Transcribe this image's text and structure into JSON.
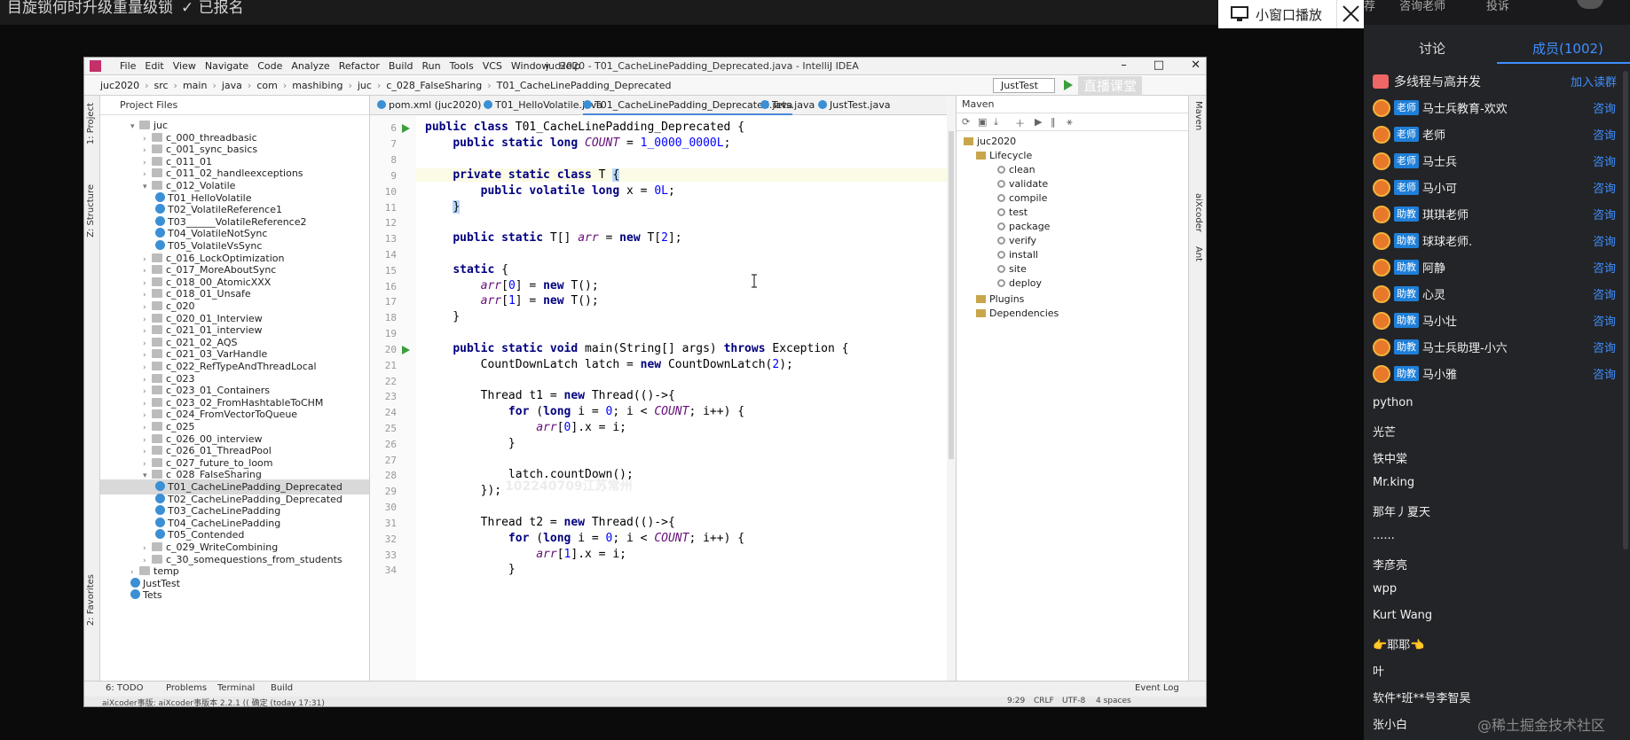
{
  "player": {
    "top_text": "目旋锁何时升级重量级锁",
    "check_text": "✓ 已报名",
    "pip_label": "小窗口播放"
  },
  "side": {
    "top_items": [
      "荐",
      "咨询老师",
      "投诉"
    ],
    "tabs": {
      "discuss": "讨论",
      "members": "成员(1002)"
    },
    "group_name": "多线程与高并发",
    "join_label": "加入读群",
    "members": [
      {
        "badge": "老师",
        "name": "马士兵教育-欢欢",
        "ask": "咨询"
      },
      {
        "badge": "老师",
        "name": "老师",
        "ask": "咨询"
      },
      {
        "badge": "老师",
        "name": "马士兵",
        "ask": "咨询"
      },
      {
        "badge": "老师",
        "name": "马小可",
        "ask": "咨询"
      },
      {
        "badge": "助教",
        "name": "琪琪老师",
        "ask": "咨询"
      },
      {
        "badge": "助教",
        "name": "球球老师.",
        "ask": "咨询"
      },
      {
        "badge": "助教",
        "name": "阿静",
        "ask": "咨询"
      },
      {
        "badge": "助教",
        "name": "心灵",
        "ask": "咨询"
      },
      {
        "badge": "助教",
        "name": "马小壮",
        "ask": "咨询"
      },
      {
        "badge": "助教",
        "name": "马士兵助理-小六",
        "ask": "咨询"
      },
      {
        "badge": "助教",
        "name": "马小雅",
        "ask": "咨询"
      }
    ],
    "plain_members": [
      "python",
      "光芒",
      "铁中棠",
      "Mr.king",
      "那年丿夏天",
      "......",
      "李彦亮",
      "wpp",
      "Kurt Wang",
      "👉耶耶👈",
      "叶",
      "软件*班**号李智昊",
      "张小白"
    ],
    "watermark": "@稀土掘金技术社区"
  },
  "ide": {
    "menu": [
      "File",
      "Edit",
      "View",
      "Navigate",
      "Code",
      "Analyze",
      "Refactor",
      "Build",
      "Run",
      "Tools",
      "VCS",
      "Window",
      "Help"
    ],
    "title": "juc2020 - T01_CacheLinePadding_Deprecated.java - IntelliJ IDEA",
    "breadcrumb": [
      "juc2020",
      "src",
      "main",
      "java",
      "com",
      "mashibing",
      "juc",
      "c_028_FalseSharing",
      "T01_CacheLinePadding_Deprecated"
    ],
    "run_config": "JustTest",
    "overlay_badge": "直播课堂",
    "left_tools": [
      "1: Project",
      "Z: Structure",
      "2: Favorites"
    ],
    "project_head": "Project Files",
    "tree": [
      {
        "label": "juc",
        "type": "folder",
        "indent": 1,
        "open": true
      },
      {
        "label": "c_000_threadbasic",
        "type": "folder",
        "indent": 2
      },
      {
        "label": "c_001_sync_basics",
        "type": "folder",
        "indent": 2
      },
      {
        "label": "c_011_01",
        "type": "folder",
        "indent": 2
      },
      {
        "label": "c_011_02_handleexceptions",
        "type": "folder",
        "indent": 2
      },
      {
        "label": "c_012_Volatile",
        "type": "folder",
        "indent": 2,
        "open": true
      },
      {
        "label": "T01_HelloVolatile",
        "type": "class",
        "indent": 3
      },
      {
        "label": "T02_VolatileReference1",
        "type": "class",
        "indent": 3
      },
      {
        "label": "T03______VolatileReference2",
        "type": "class",
        "indent": 3
      },
      {
        "label": "T04_VolatileNotSync",
        "type": "class",
        "indent": 3
      },
      {
        "label": "T05_VolatileVsSync",
        "type": "class",
        "indent": 3
      },
      {
        "label": "c_016_LockOptimization",
        "type": "folder",
        "indent": 2
      },
      {
        "label": "c_017_MoreAboutSync",
        "type": "folder",
        "indent": 2
      },
      {
        "label": "c_018_00_AtomicXXX",
        "type": "folder",
        "indent": 2
      },
      {
        "label": "c_018_01_Unsafe",
        "type": "folder",
        "indent": 2
      },
      {
        "label": "c_020",
        "type": "folder",
        "indent": 2
      },
      {
        "label": "c_020_01_Interview",
        "type": "folder",
        "indent": 2
      },
      {
        "label": "c_021_01_interview",
        "type": "folder",
        "indent": 2
      },
      {
        "label": "c_021_02_AQS",
        "type": "folder",
        "indent": 2
      },
      {
        "label": "c_021_03_VarHandle",
        "type": "folder",
        "indent": 2
      },
      {
        "label": "c_022_RefTypeAndThreadLocal",
        "type": "folder",
        "indent": 2
      },
      {
        "label": "c_023",
        "type": "folder",
        "indent": 2
      },
      {
        "label": "c_023_01_Containers",
        "type": "folder",
        "indent": 2
      },
      {
        "label": "c_023_02_FromHashtableToCHM",
        "type": "folder",
        "indent": 2
      },
      {
        "label": "c_024_FromVectorToQueue",
        "type": "folder",
        "indent": 2
      },
      {
        "label": "c_025",
        "type": "folder",
        "indent": 2
      },
      {
        "label": "c_026_00_interview",
        "type": "folder",
        "indent": 2
      },
      {
        "label": "c_026_01_ThreadPool",
        "type": "folder",
        "indent": 2
      },
      {
        "label": "c_027_future_to_loom",
        "type": "folder",
        "indent": 2
      },
      {
        "label": "c_028_FalseSharing",
        "type": "folder",
        "indent": 2,
        "open": true
      },
      {
        "label": "T01_CacheLinePadding_Deprecated",
        "type": "class",
        "indent": 3,
        "selected": true
      },
      {
        "label": "T02_CacheLinePadding_Deprecated",
        "type": "class",
        "indent": 3
      },
      {
        "label": "T03_CacheLinePadding",
        "type": "class",
        "indent": 3
      },
      {
        "label": "T04_CacheLinePadding",
        "type": "class",
        "indent": 3
      },
      {
        "label": "T05_Contended",
        "type": "class",
        "indent": 3
      },
      {
        "label": "c_029_WriteCombining",
        "type": "folder",
        "indent": 2
      },
      {
        "label": "c_30_somequestions_from_students",
        "type": "folder",
        "indent": 2
      },
      {
        "label": "temp",
        "type": "folder",
        "indent": 1
      },
      {
        "label": "JustTest",
        "type": "class",
        "indent": 1
      },
      {
        "label": "Tets",
        "type": "class",
        "indent": 1
      }
    ],
    "editor_tabs": [
      "pom.xml (juc2020)",
      "T01_HelloVolatile.java",
      "T01_CacheLinePadding_Deprecated.java",
      "Tets.java",
      "JustTest.java"
    ],
    "line_numbers": [
      "6",
      "7",
      "8",
      "9",
      "10",
      "11",
      "12",
      "13",
      "14",
      "15",
      "16",
      "17",
      "18",
      "19",
      "20",
      "21",
      "22",
      "23",
      "24",
      "25",
      "26",
      "27",
      "28",
      "29",
      "30",
      "31",
      "32",
      "33",
      "34"
    ],
    "code_overlay": "102240709江苏常州",
    "maven": {
      "head": "Maven",
      "project": "juc2020",
      "lifecycle": "Lifecycle",
      "goals": [
        "clean",
        "validate",
        "compile",
        "test",
        "package",
        "verify",
        "install",
        "site",
        "deploy"
      ],
      "plugins": "Plugins",
      "dependencies": "Dependencies"
    },
    "right_tools": [
      "Maven",
      "aiXcoder",
      "Ant"
    ],
    "bottom_tools": [
      "6: TODO",
      "Problems",
      "Terminal",
      "Build",
      "Event Log"
    ],
    "status_left": "aiXcoder事版: aiXcoder事版本 2.2.1 (( 确定 (today 17:31)",
    "status_right": [
      "9:29",
      "CRLF",
      "UTF-8",
      "4 spaces"
    ]
  },
  "colors": {
    "accent_blue": "#3f8fff",
    "teacher_badge": "#1f7fd8",
    "run_green": "#3a9e3a",
    "keyword": "#000080",
    "number": "#0000ff"
  }
}
